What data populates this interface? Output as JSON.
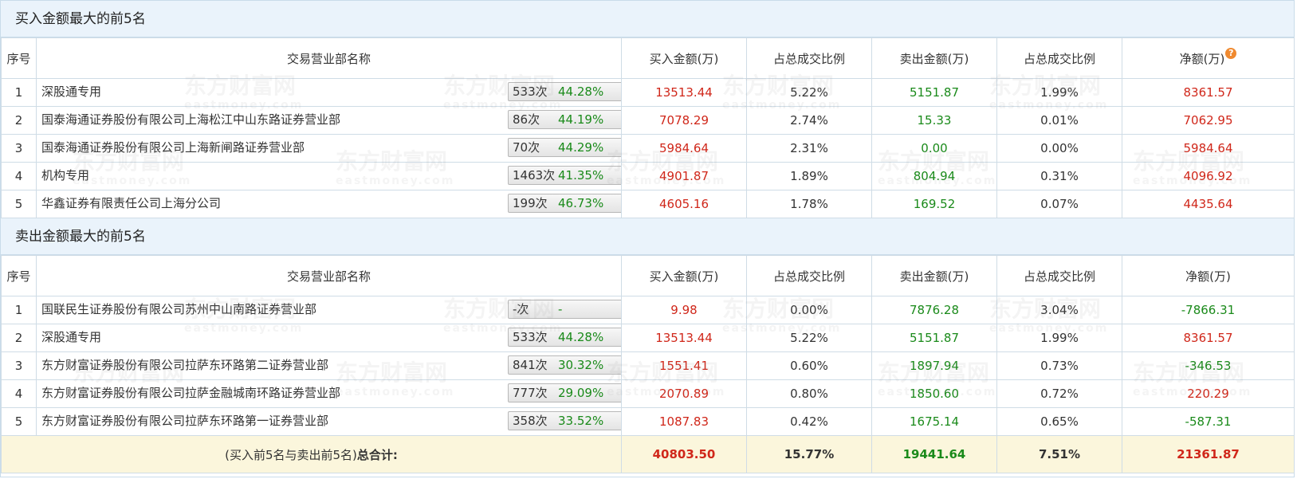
{
  "buy_section": {
    "title": "买入金额最大的前5名",
    "headers": [
      "序号",
      "交易营业部名称",
      "买入金额(万)",
      "占总成交比例",
      "卖出金额(万)",
      "占总成交比例",
      "净额(万)"
    ],
    "help_icon": "question-icon",
    "rows": [
      {
        "idx": "1",
        "name": "深股通专用",
        "count": "533次",
        "pct": "44.28%",
        "icon": "question-icon",
        "buy": "13513.44",
        "buy_ratio": "5.22%",
        "sell": "5151.87",
        "sell_ratio": "1.99%",
        "net": "8361.57"
      },
      {
        "idx": "2",
        "name": "国泰海通证券股份有限公司上海松江中山东路证券营业部",
        "count": "86次",
        "pct": "44.19%",
        "icon": "arrow-right-icon",
        "buy": "7078.29",
        "buy_ratio": "2.74%",
        "sell": "15.33",
        "sell_ratio": "0.01%",
        "net": "7062.95"
      },
      {
        "idx": "3",
        "name": "国泰海通证券股份有限公司上海新闸路证券营业部",
        "count": "70次",
        "pct": "44.29%",
        "icon": "arrow-right-icon",
        "buy": "5984.64",
        "buy_ratio": "2.31%",
        "sell": "0.00",
        "sell_ratio": "0.00%",
        "net": "5984.64"
      },
      {
        "idx": "4",
        "name": "机构专用",
        "count": "1463次",
        "pct": "41.35%",
        "icon": "arrow-right-icon",
        "buy": "4901.87",
        "buy_ratio": "1.89%",
        "sell": "804.94",
        "sell_ratio": "0.31%",
        "net": "4096.92"
      },
      {
        "idx": "5",
        "name": "华鑫证券有限责任公司上海分公司",
        "count": "199次",
        "pct": "46.73%",
        "icon": "arrow-right-icon",
        "buy": "4605.16",
        "buy_ratio": "1.78%",
        "sell": "169.52",
        "sell_ratio": "0.07%",
        "net": "4435.64"
      }
    ]
  },
  "sell_section": {
    "title": "卖出金额最大的前5名",
    "headers": [
      "序号",
      "交易营业部名称",
      "买入金额(万)",
      "占总成交比例",
      "卖出金额(万)",
      "占总成交比例",
      "净额(万)"
    ],
    "rows": [
      {
        "idx": "1",
        "name": "国联民生证券股份有限公司苏州中山南路证券营业部",
        "count": "-次",
        "pct": "-",
        "icon": "question-icon",
        "buy": "9.98",
        "buy_ratio": "0.00%",
        "sell": "7876.28",
        "sell_ratio": "3.04%",
        "net": "-7866.31"
      },
      {
        "idx": "2",
        "name": "深股通专用",
        "count": "533次",
        "pct": "44.28%",
        "icon": "arrow-right-icon",
        "buy": "13513.44",
        "buy_ratio": "5.22%",
        "sell": "5151.87",
        "sell_ratio": "1.99%",
        "net": "8361.57"
      },
      {
        "idx": "3",
        "name": "东方财富证券股份有限公司拉萨东环路第二证券营业部",
        "count": "841次",
        "pct": "30.32%",
        "icon": "arrow-right-icon",
        "buy": "1551.41",
        "buy_ratio": "0.60%",
        "sell": "1897.94",
        "sell_ratio": "0.73%",
        "net": "-346.53"
      },
      {
        "idx": "4",
        "name": "东方财富证券股份有限公司拉萨金融城南环路证券营业部",
        "count": "777次",
        "pct": "29.09%",
        "icon": "arrow-right-icon",
        "buy": "2070.89",
        "buy_ratio": "0.80%",
        "sell": "1850.60",
        "sell_ratio": "0.72%",
        "net": "220.29"
      },
      {
        "idx": "5",
        "name": "东方财富证券股份有限公司拉萨东环路第一证券营业部",
        "count": "358次",
        "pct": "33.52%",
        "icon": "arrow-right-icon",
        "buy": "1087.83",
        "buy_ratio": "0.42%",
        "sell": "1675.14",
        "sell_ratio": "0.65%",
        "net": "-587.31"
      }
    ]
  },
  "total": {
    "label_prefix": "(买入前5名与卖出前5名)",
    "label_bold": "总合计:",
    "buy": "40803.50",
    "buy_ratio": "15.77%",
    "sell": "19441.64",
    "sell_ratio": "7.51%",
    "net": "21361.87"
  },
  "watermark": {
    "cn": "东方财富网",
    "en": "eastmoney.com"
  },
  "colors": {
    "positive": "#d0271a",
    "negative": "#1a8a1a",
    "header_bg": "#eaf3fb",
    "total_bg": "#fbf6dc",
    "border": "#cfdce6"
  }
}
